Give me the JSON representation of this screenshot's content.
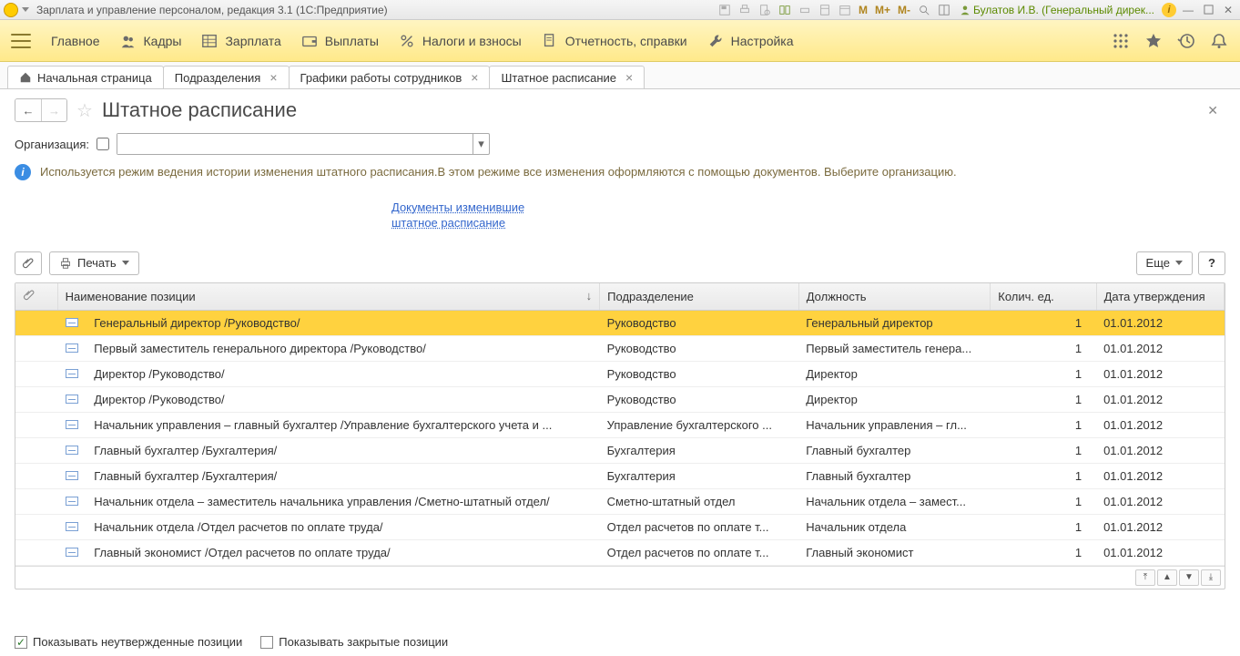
{
  "titlebar": {
    "title": "Зарплата и управление персоналом, редакция 3.1  (1С:Предприятие)",
    "user": "Булатов И.В. (Генеральный дирек...",
    "m_labels": [
      "M",
      "M+",
      "M-"
    ]
  },
  "mainmenu": {
    "items": [
      {
        "label": "Главное",
        "icon": "home"
      },
      {
        "label": "Кадры",
        "icon": "people"
      },
      {
        "label": "Зарплата",
        "icon": "table"
      },
      {
        "label": "Выплаты",
        "icon": "wallet"
      },
      {
        "label": "Налоги и взносы",
        "icon": "percent"
      },
      {
        "label": "Отчетность, справки",
        "icon": "doc"
      },
      {
        "label": "Настройка",
        "icon": "wrench"
      }
    ]
  },
  "tabs": [
    {
      "label": "Начальная страница",
      "home": true,
      "closable": false
    },
    {
      "label": "Подразделения",
      "closable": true
    },
    {
      "label": "Графики работы сотрудников",
      "closable": true
    },
    {
      "label": "Штатное расписание",
      "closable": true,
      "active": true
    }
  ],
  "page": {
    "title": "Штатное расписание"
  },
  "filter": {
    "org_label": "Организация:"
  },
  "info": {
    "text": "Используется режим ведения истории изменения штатного расписания.В этом режиме все изменения оформляются с помощью документов. Выберите организацию."
  },
  "doclink": {
    "line1": "Документы изменившие",
    "line2": "штатное расписание"
  },
  "toolbar": {
    "print": "Печать",
    "more": "Еще",
    "help": "?"
  },
  "columns": {
    "name": "Наименование позиции",
    "dept": "Подразделение",
    "post": "Должность",
    "qty": "Колич. ед.",
    "date": "Дата утверждения"
  },
  "rows": [
    {
      "name": "Генеральный директор /Руководство/",
      "dept": "Руководство",
      "post": "Генеральный директор",
      "qty": "1",
      "date": "01.01.2012",
      "selected": true
    },
    {
      "name": "Первый заместитель генерального директора /Руководство/",
      "dept": "Руководство",
      "post": "Первый заместитель генера...",
      "qty": "1",
      "date": "01.01.2012"
    },
    {
      "name": "Директор /Руководство/",
      "dept": "Руководство",
      "post": "Директор",
      "qty": "1",
      "date": "01.01.2012"
    },
    {
      "name": "Директор /Руководство/",
      "dept": "Руководство",
      "post": "Директор",
      "qty": "1",
      "date": "01.01.2012"
    },
    {
      "name": "Начальник управления – главный бухгалтер /Управление бухгалтерского учета и ...",
      "dept": "Управление бухгалтерского ...",
      "post": "Начальник управления – гл...",
      "qty": "1",
      "date": "01.01.2012"
    },
    {
      "name": "Главный бухгалтер /Бухгалтерия/",
      "dept": "Бухгалтерия",
      "post": "Главный бухгалтер",
      "qty": "1",
      "date": "01.01.2012"
    },
    {
      "name": "Главный бухгалтер /Бухгалтерия/",
      "dept": "Бухгалтерия",
      "post": "Главный бухгалтер",
      "qty": "1",
      "date": "01.01.2012"
    },
    {
      "name": "Начальник отдела – заместитель начальника управления /Сметно-штатный отдел/",
      "dept": "Сметно-штатный отдел",
      "post": "Начальник отдела – замест...",
      "qty": "1",
      "date": "01.01.2012"
    },
    {
      "name": "Начальник отдела /Отдел расчетов по оплате труда/",
      "dept": "Отдел расчетов по оплате т...",
      "post": "Начальник отдела",
      "qty": "1",
      "date": "01.01.2012"
    },
    {
      "name": "Главный экономист /Отдел расчетов по оплате труда/",
      "dept": "Отдел расчетов по оплате т...",
      "post": "Главный экономист",
      "qty": "1",
      "date": "01.01.2012"
    }
  ],
  "footer": {
    "show_draft": "Показывать неутвержденные позиции",
    "show_closed": "Показывать закрытые позиции"
  }
}
